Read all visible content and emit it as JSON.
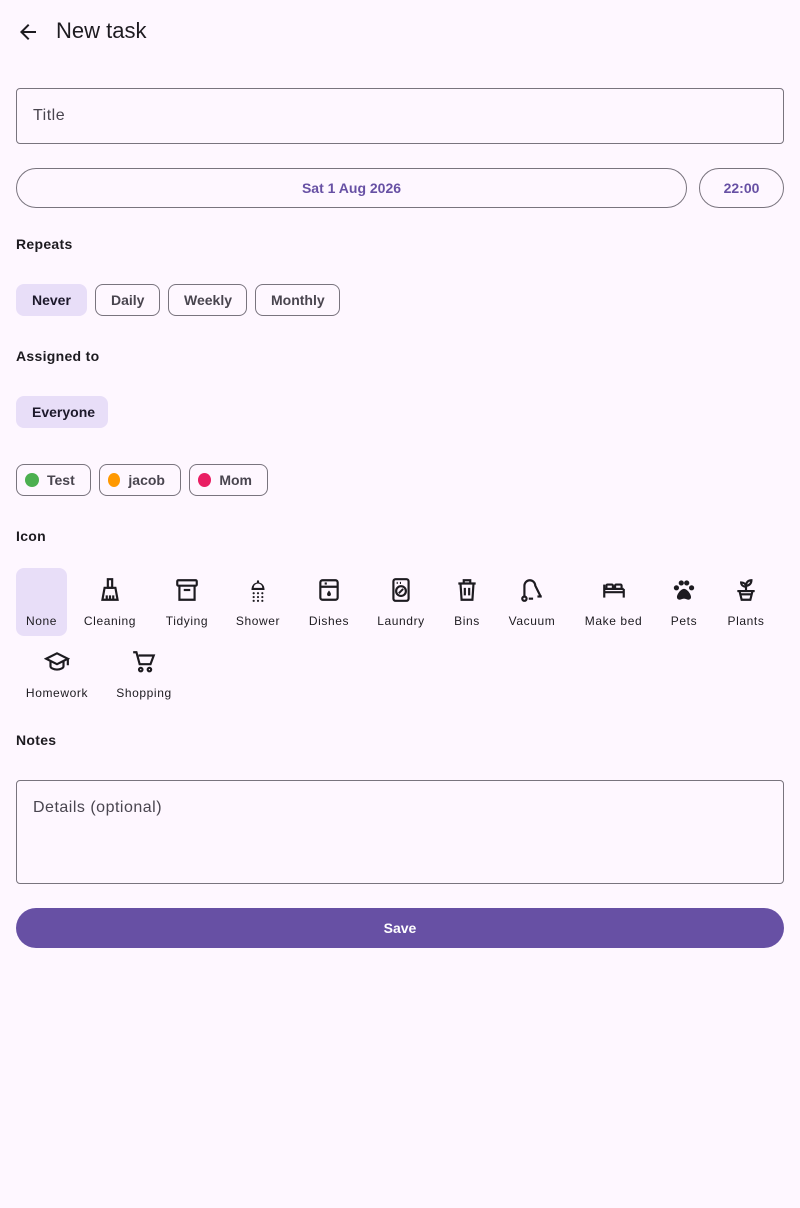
{
  "header": {
    "title": "New task",
    "back_icon": "arrow-back-icon"
  },
  "title_field": {
    "placeholder": "Title",
    "value": ""
  },
  "date_button": {
    "label": "Sat 1 Aug 2026"
  },
  "time_button": {
    "label": "22:00"
  },
  "repeats": {
    "label": "Repeats",
    "options": [
      {
        "label": "Never",
        "selected": true
      },
      {
        "label": "Daily",
        "selected": false
      },
      {
        "label": "Weekly",
        "selected": false
      },
      {
        "label": "Monthly",
        "selected": false
      }
    ]
  },
  "assigned": {
    "label": "Assigned to",
    "everyone": {
      "label": "Everyone",
      "selected": true
    },
    "members": [
      {
        "label": "Test",
        "color": "#4caf50"
      },
      {
        "label": "jacob",
        "color": "#ff9800"
      },
      {
        "label": "Mom",
        "color": "#e91e63"
      }
    ]
  },
  "icons": {
    "label": "Icon",
    "items": [
      {
        "label": "None",
        "icon": "none",
        "selected": true
      },
      {
        "label": "Cleaning",
        "icon": "broom-icon"
      },
      {
        "label": "Tidying",
        "icon": "archive-box-icon"
      },
      {
        "label": "Shower",
        "icon": "shower-icon"
      },
      {
        "label": "Dishes",
        "icon": "dishwasher-icon"
      },
      {
        "label": "Laundry",
        "icon": "washing-machine-icon"
      },
      {
        "label": "Bins",
        "icon": "trash-bin-icon"
      },
      {
        "label": "Vacuum",
        "icon": "vacuum-icon"
      },
      {
        "label": "Make bed",
        "icon": "bed-icon"
      },
      {
        "label": "Pets",
        "icon": "paw-icon"
      },
      {
        "label": "Plants",
        "icon": "potted-plant-icon"
      },
      {
        "label": "Homework",
        "icon": "graduation-cap-icon"
      },
      {
        "label": "Shopping",
        "icon": "shopping-cart-icon"
      }
    ]
  },
  "notes": {
    "label": "Notes",
    "placeholder": "Details (optional)",
    "value": ""
  },
  "save_button": {
    "label": "Save"
  },
  "colors": {
    "primary": "#6750a4",
    "selected_chip": "#e8def8",
    "background": "#fef7ff",
    "outline": "#79747e"
  }
}
